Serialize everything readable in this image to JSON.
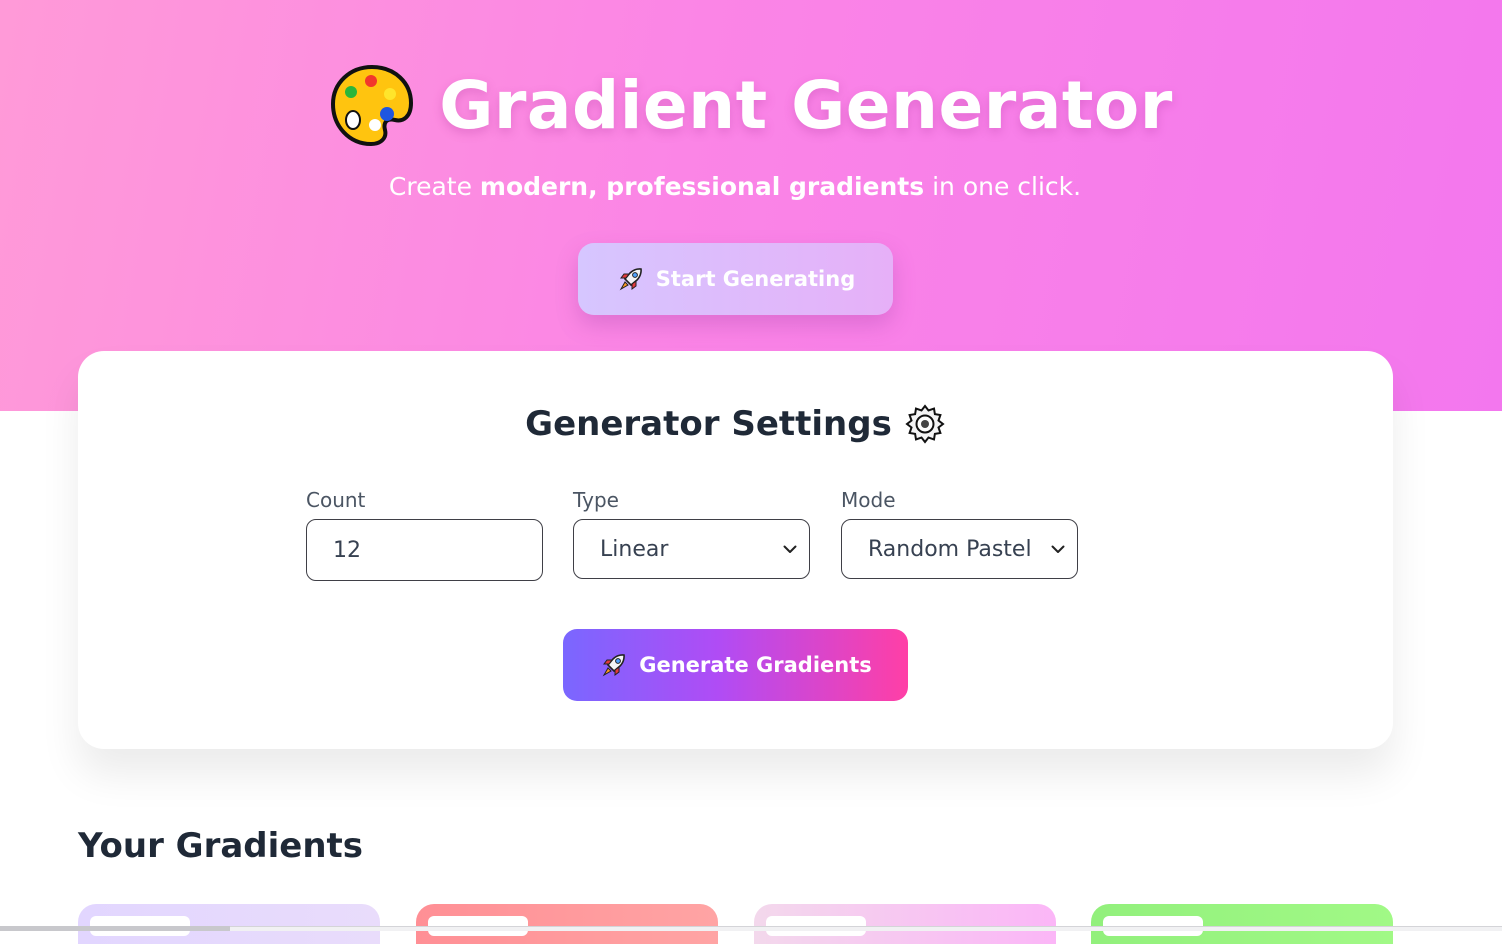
{
  "hero": {
    "title": "Gradient Generator",
    "subtitle_prefix": "Create ",
    "subtitle_bold": "modern, professional gradients",
    "subtitle_suffix": " in one click.",
    "start_button_label": "Start Generating"
  },
  "settings": {
    "title": "Generator Settings",
    "fields": [
      {
        "label": "Count",
        "value": "12",
        "control": "number-input"
      },
      {
        "label": "Type",
        "value": "Linear",
        "control": "select"
      },
      {
        "label": "Mode",
        "value": "Random Pastel",
        "control": "select"
      }
    ],
    "generate_button_label": "Generate Gradients"
  },
  "gradients_section": {
    "title": "Your Gradients",
    "cards": [
      {
        "gradient_from": "#e2d6ff",
        "gradient_to": "#e9dcfb"
      },
      {
        "gradient_from": "#ff8f95",
        "gradient_to": "#ffa4a4"
      },
      {
        "gradient_from": "#f3d8ec",
        "gradient_to": "#fbb6f7"
      },
      {
        "gradient_from": "#92f07c",
        "gradient_to": "#a1f986"
      }
    ]
  },
  "icons": {
    "hero_title": "palette-icon",
    "start_button": "rocket-icon",
    "settings_title": "gear-icon",
    "generate_button": "rocket-icon",
    "select": "chevron-down-icon"
  },
  "colors": {
    "hero_gradient_from": "#ff9ad8",
    "hero_gradient_to": "#f377ee",
    "start_button_from": "#d6c6ff",
    "start_button_to": "#e6b0f8",
    "generate_button_from": "#7a67ff",
    "generate_button_mid": "#b04cf5",
    "generate_button_to": "#ff3fa6",
    "heading_text": "#1f2937",
    "label_text": "#4b5563"
  }
}
